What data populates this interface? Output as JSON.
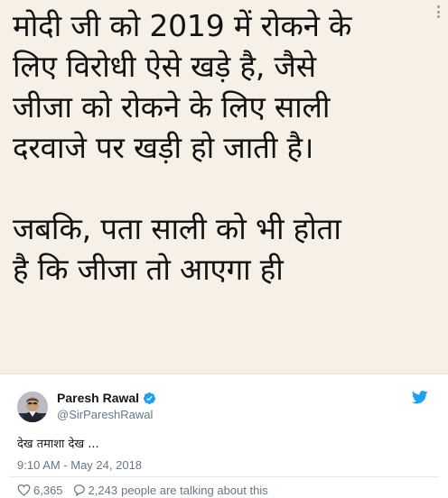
{
  "image": {
    "lines": [
      "मोदी जी को 2019 में रोकने के",
      "लिए विरोधी ऐसे खड़े है, जैसे",
      "जीजा को रोकने के लिए साली",
      "दरवाजे पर खड़ी हो जाती है।",
      "जबकि, पता साली को भी होता",
      "है कि जीजा तो आएगा ही"
    ]
  },
  "tweet": {
    "author_name": "Paresh Rawal",
    "handle": "@SirPareshRawal",
    "text": "देख तमाशा देख ...",
    "timestamp": "9:10 AM - May 24, 2018",
    "likes": "6,365",
    "replies": "2,243",
    "talking": "people are talking about this"
  },
  "colors": {
    "twitter_blue": "#1da1f2",
    "text_dark": "#14171a",
    "text_muted": "#657786",
    "image_background": "#f6f0e6"
  },
  "icons": {
    "verified": "verified-badge-icon",
    "bird": "twitter-bird-icon",
    "like": "heart-icon",
    "reply": "speech-bubble-icon",
    "menu": "vertical-dots-icon"
  }
}
